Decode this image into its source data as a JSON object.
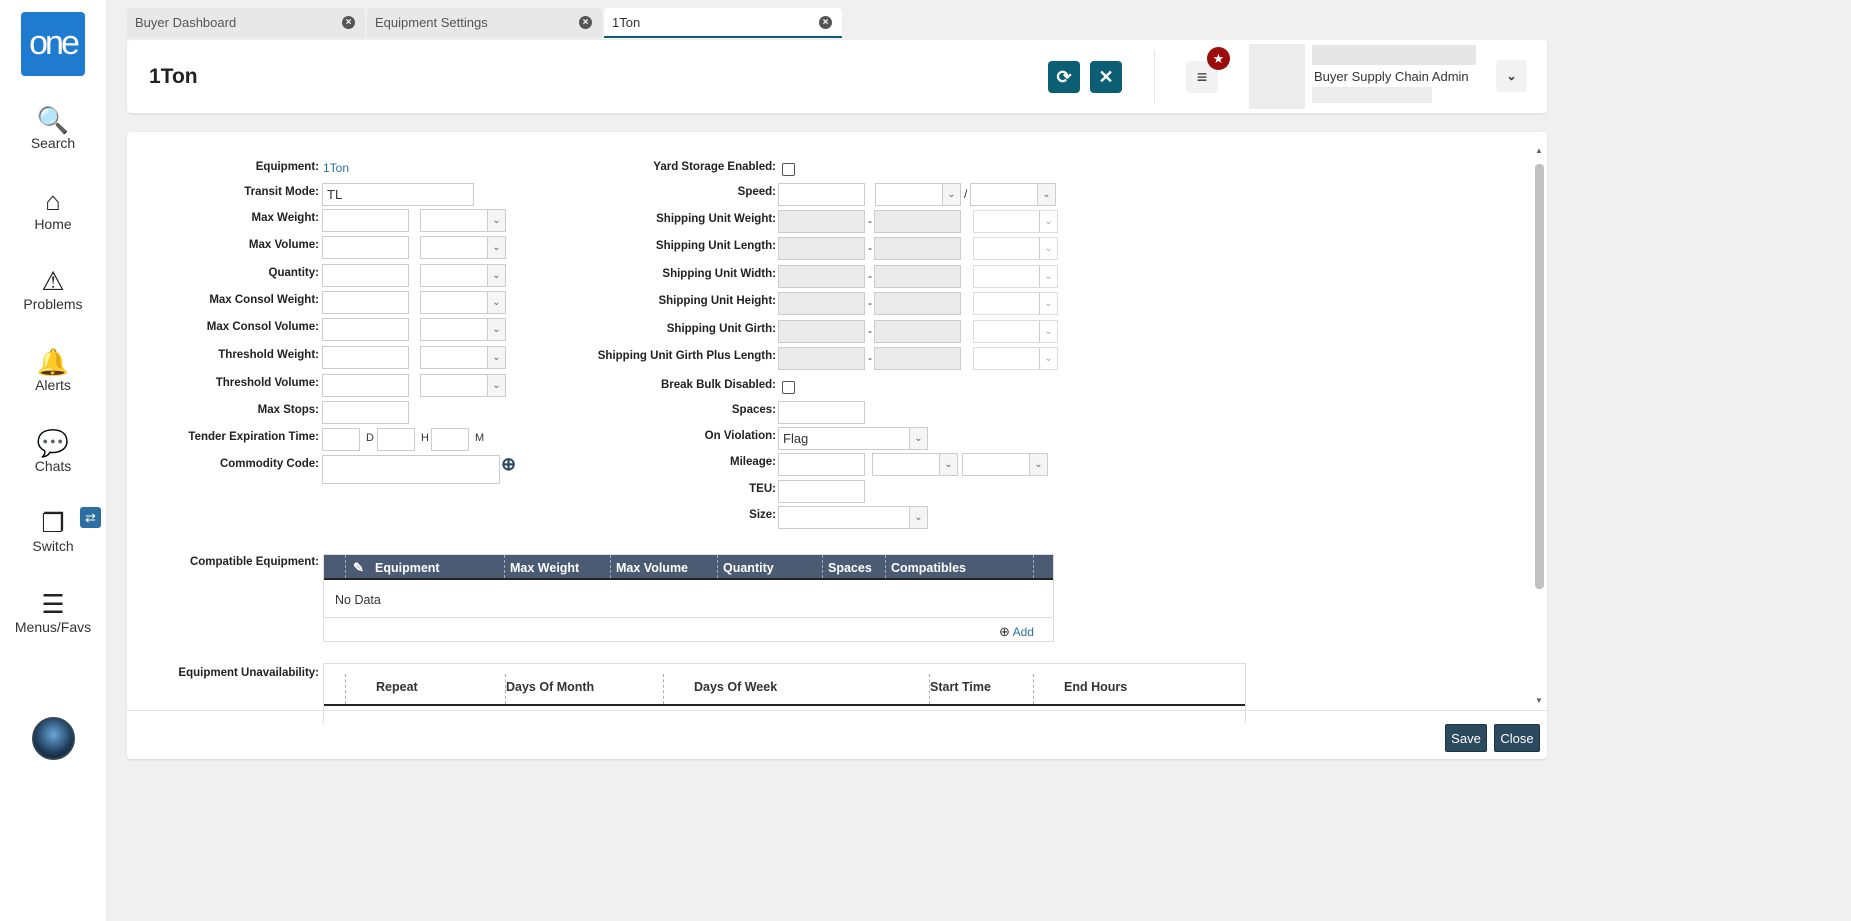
{
  "app": {
    "logo": "one",
    "accent": "#0b5e73",
    "brand": "#1e7bd0"
  },
  "sidebar": {
    "items": [
      {
        "label": "Search",
        "icon": "search-icon",
        "glyph": "🔍"
      },
      {
        "label": "Home",
        "icon": "home-icon",
        "glyph": "⌂"
      },
      {
        "label": "Problems",
        "icon": "warning-icon",
        "glyph": "⚠"
      },
      {
        "label": "Alerts",
        "icon": "bell-icon",
        "glyph": "🔔"
      },
      {
        "label": "Chats",
        "icon": "chat-icon",
        "glyph": "💬"
      },
      {
        "label": "Switch",
        "icon": "switch-icon",
        "glyph": "❐"
      },
      {
        "label": "Menus/Favs",
        "icon": "menu-icon",
        "glyph": "☰"
      }
    ]
  },
  "tabs": [
    {
      "label": "Buyer Dashboard"
    },
    {
      "label": "Equipment Settings"
    },
    {
      "label": "1Ton",
      "active": true
    }
  ],
  "header": {
    "title": "1Ton",
    "user_role": "Buyer Supply Chain Admin"
  },
  "form_left": [
    {
      "label": "Equipment:",
      "type": "text",
      "value": "1Ton"
    },
    {
      "label": "Transit Mode:",
      "type": "input",
      "value": "TL"
    },
    {
      "label": "Max Weight:",
      "type": "input-select"
    },
    {
      "label": "Max Volume:",
      "type": "input-select"
    },
    {
      "label": "Quantity:",
      "type": "input-select"
    },
    {
      "label": "Max Consol Weight:",
      "type": "input-select"
    },
    {
      "label": "Max Consol Volume:",
      "type": "input-select"
    },
    {
      "label": "Threshold Weight:",
      "type": "input-select"
    },
    {
      "label": "Threshold Volume:",
      "type": "input-select"
    },
    {
      "label": "Max Stops:",
      "type": "input"
    },
    {
      "label": "Tender Expiration Time:",
      "type": "dhm",
      "units": [
        "D",
        "H",
        "M"
      ]
    },
    {
      "label": "Commodity Code:",
      "type": "lookup"
    }
  ],
  "form_right": [
    {
      "label": "Yard Storage Enabled:",
      "type": "checkbox",
      "checked": false
    },
    {
      "label": "Speed:",
      "type": "speed"
    },
    {
      "label": "Shipping Unit Weight:",
      "type": "range"
    },
    {
      "label": "Shipping Unit Length:",
      "type": "range"
    },
    {
      "label": "Shipping Unit Width:",
      "type": "range"
    },
    {
      "label": "Shipping Unit Height:",
      "type": "range"
    },
    {
      "label": "Shipping Unit Girth:",
      "type": "range"
    },
    {
      "label": "Shipping Unit Girth Plus Length:",
      "type": "range"
    },
    {
      "label": "Break Bulk Disabled:",
      "type": "checkbox",
      "checked": false
    },
    {
      "label": "Spaces:",
      "type": "input"
    },
    {
      "label": "On Violation:",
      "type": "select",
      "value": "Flag"
    },
    {
      "label": "Mileage:",
      "type": "mileage"
    },
    {
      "label": "TEU:",
      "type": "input"
    },
    {
      "label": "Size:",
      "type": "select",
      "value": ""
    }
  ],
  "compatible": {
    "label": "Compatible Equipment:",
    "columns": [
      "Equipment",
      "Max Weight",
      "Max Volume",
      "Quantity",
      "Spaces",
      "Compatibles"
    ],
    "empty": "No Data",
    "add_label": "Add"
  },
  "unavailability": {
    "label": "Equipment Unavailability:",
    "columns": [
      "Repeat",
      "Days Of Month",
      "Days Of Week",
      "Start Time",
      "End Hours"
    ]
  },
  "footer": {
    "save": "Save",
    "close": "Close"
  }
}
